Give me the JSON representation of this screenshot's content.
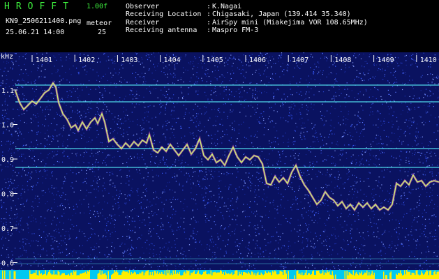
{
  "header": {
    "title": "HROFFT",
    "version": "1.00f",
    "filename": "KN9_2506211400.png",
    "datetime": "25.06.21 14:00",
    "meteor_label": "meteor",
    "meteor_count": "25"
  },
  "info": [
    {
      "label": "Observer",
      "value": "K.Nagai"
    },
    {
      "label": "Receiving Location",
      "value": "Chigasaki, Japan (139.414 35.340)"
    },
    {
      "label": "Receiver",
      "value": "AirSpy mini (Miakejima VOR 108.65MHz)"
    },
    {
      "label": "Receiving antenna",
      "value": "Maspro FM-3"
    }
  ],
  "spectrogram": {
    "y_unit": "kHz",
    "x_ticks": [
      "1401",
      "1402",
      "1403",
      "1404",
      "1405",
      "1406",
      "1407",
      "1408",
      "1409",
      "1410"
    ],
    "y_ticks": [
      "1.1",
      "1.0",
      "0.9",
      "0.8",
      "0.7",
      "0.6"
    ],
    "colors": {
      "background": "#0a1260",
      "noise": "#3a5cff",
      "carrier": "#4fd6e8",
      "trace": "#c8ff6a",
      "trace_edge": "#ff6ad0",
      "bottom_bar": "#ffee00",
      "cyan_bar": "#00c8f0"
    }
  }
}
